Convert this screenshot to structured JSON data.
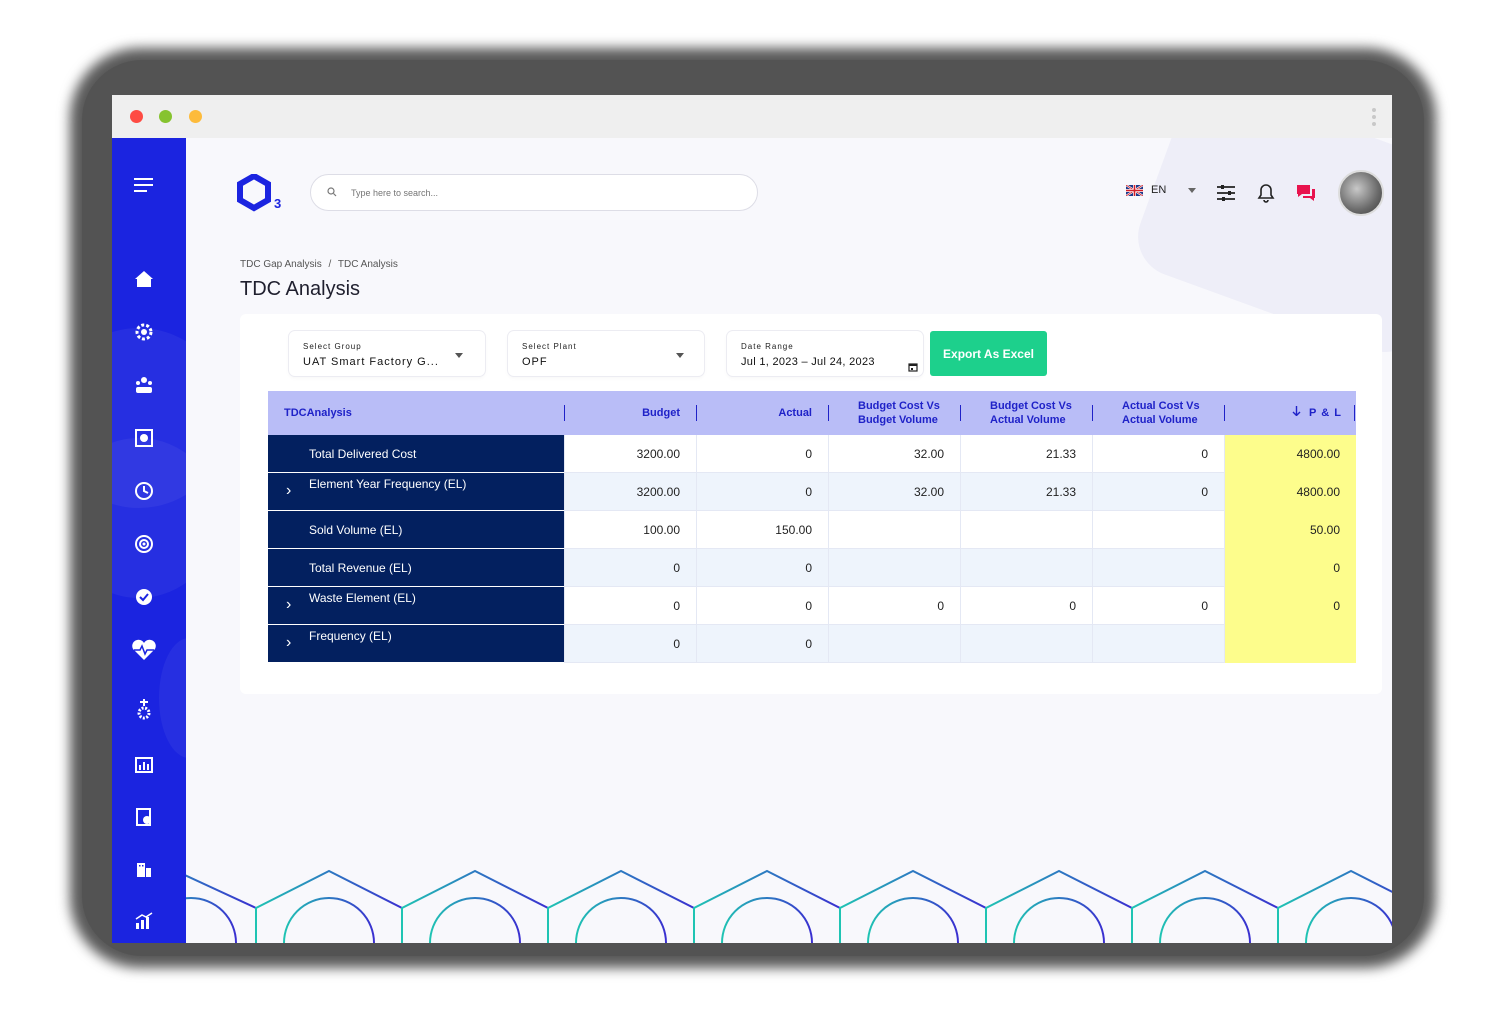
{
  "search": {
    "placeholder": "Type here to search..."
  },
  "header": {
    "language": "EN"
  },
  "breadcrumb": [
    "TDC Gap Analysis",
    "/",
    "TDC Analysis"
  ],
  "page_title": "TDC Analysis",
  "filters": {
    "group_label": "Select Group",
    "group_value": "UAT Smart Factory G...",
    "plant_label": "Select Plant",
    "plant_value": "OPF",
    "date_label": "Date Range",
    "date_value": "Jul 1, 2023  –  Jul 24, 2023"
  },
  "export_label": "Export As Excel",
  "table": {
    "headers": [
      "TDCAnalysis",
      "Budget",
      "Actual",
      "Budget Cost Vs Budget Volume",
      "Budget Cost Vs Actual Volume",
      "Actual Cost Vs Actual Volume",
      "P & L"
    ],
    "rows": [
      {
        "name": "Total Delivered Cost",
        "values": [
          "3200.00",
          "0",
          "32.00",
          "21.33",
          "0",
          "4800.00"
        ]
      },
      {
        "name": "Element Year Frequency (EL)",
        "values": [
          "3200.00",
          "0",
          "32.00",
          "21.33",
          "0",
          "4800.00"
        ]
      },
      {
        "name": "Sold Volume (EL)",
        "values": [
          "100.00",
          "150.00",
          "",
          "",
          "",
          "50.00"
        ]
      },
      {
        "name": "Total Revenue (EL)",
        "values": [
          "0",
          "0",
          "",
          "",
          "",
          "0"
        ]
      },
      {
        "name": "Waste Element (EL)",
        "values": [
          "0",
          "0",
          "0",
          "0",
          "0",
          "0"
        ]
      },
      {
        "name": "Frequency (EL)",
        "values": [
          "0",
          "0",
          "",
          "",
          "",
          ""
        ]
      }
    ]
  },
  "colors": {
    "sidebar": "#1b24e0",
    "accent": "#1dd08c",
    "row_header": "#03205f",
    "pl_highlight": "#fdfd8c"
  }
}
